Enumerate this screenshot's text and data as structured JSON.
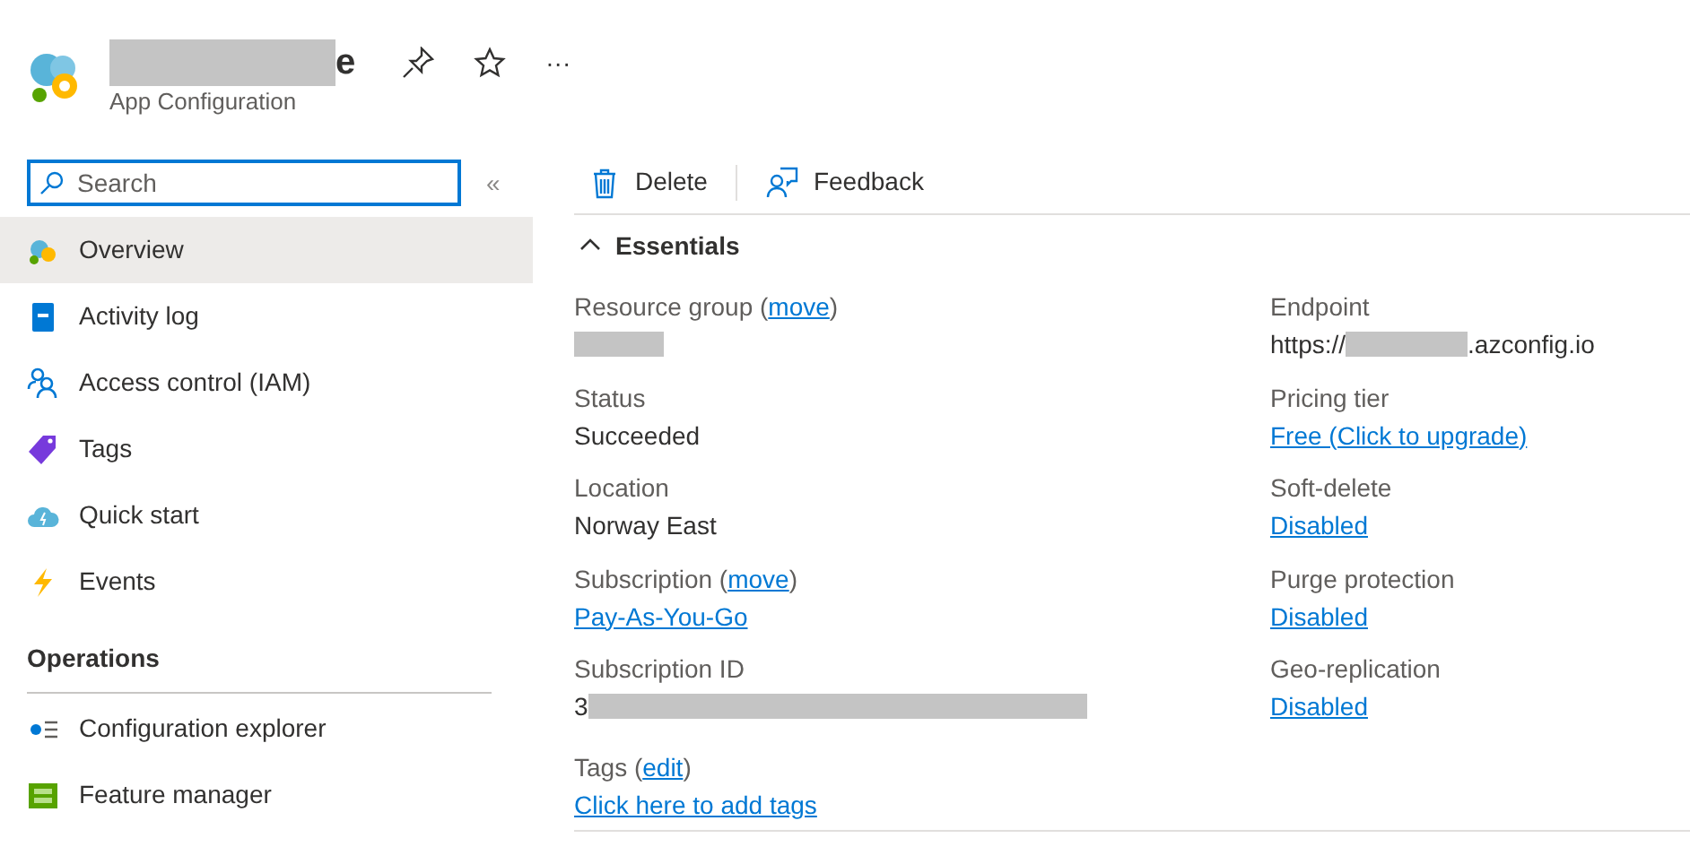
{
  "header": {
    "title_visible": "e",
    "subtitle": "App Configuration",
    "actions": [
      {
        "kind": "pin"
      },
      {
        "kind": "star"
      },
      {
        "kind": "more",
        "label": "···"
      }
    ]
  },
  "sidebar": {
    "search": {
      "placeholder": "Search"
    },
    "collapse": "«",
    "items": [
      {
        "label": "Overview",
        "kind": "overview",
        "selected": true
      },
      {
        "label": "Activity log",
        "kind": "log",
        "selected": false
      },
      {
        "label": "Access control (IAM)",
        "kind": "people",
        "selected": false
      },
      {
        "label": "Tags",
        "kind": "tag",
        "selected": false
      },
      {
        "label": "Quick start",
        "kind": "cloud",
        "selected": false
      },
      {
        "label": "Events",
        "kind": "bolt",
        "selected": false
      }
    ],
    "section": "Operations",
    "section_items": [
      {
        "label": "Configuration explorer",
        "kind": "config",
        "selected": false
      },
      {
        "label": "Feature manager",
        "kind": "feature",
        "selected": false
      }
    ]
  },
  "toolbar": [
    {
      "label": "Delete",
      "kind": "trash"
    },
    {
      "label": "Feedback",
      "kind": "feedback"
    }
  ],
  "essentials": {
    "title": "Essentials",
    "expanded": true,
    "left": [
      {
        "label": "Resource group (",
        "action": "move",
        "label_end": ")",
        "kind": "redacted"
      },
      {
        "label": "Status",
        "kind": "text",
        "value": "Succeeded"
      },
      {
        "label": "Location",
        "kind": "text",
        "value": "Norway East"
      },
      {
        "label": "Subscription (",
        "action": "move",
        "label_end": ")",
        "kind": "link",
        "value": "Pay-As-You-Go"
      },
      {
        "label": "Subscription ID",
        "kind": "redacted_suffix",
        "value_prefix": "3"
      }
    ],
    "right": [
      {
        "label": "Endpoint",
        "kind": "redacted_mid",
        "value_prefix": "https://",
        "value_suffix": ".azconfig.io"
      },
      {
        "label": "Pricing tier",
        "kind": "link",
        "value": "Free (Click to upgrade)"
      },
      {
        "label": "Soft-delete",
        "kind": "link",
        "value": "Disabled"
      },
      {
        "label": "Purge protection",
        "kind": "link",
        "value": "Disabled"
      },
      {
        "label": "Geo-replication",
        "kind": "link",
        "value": "Disabled"
      }
    ],
    "tags": {
      "label": "Tags (",
      "action": "edit",
      "label_end": ")",
      "value": "Click here to add tags"
    }
  }
}
